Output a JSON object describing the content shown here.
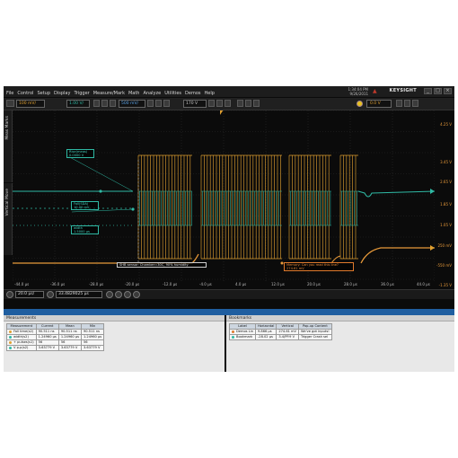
{
  "window": {
    "sysinfo_line1": "1:34:04 PM",
    "sysinfo_line2": "9/26/2011",
    "brand": "KEYSIGHT",
    "menu": [
      "File",
      "Control",
      "Setup",
      "Display",
      "Trigger",
      "Measure/Mark",
      "Math",
      "Analyze",
      "Utilities",
      "Demos",
      "Help"
    ]
  },
  "toolbar": {
    "chan1": "100 mV/",
    "chan2": "1.00 V/",
    "chan3": "500 mV/",
    "chan4": "170 V",
    "trigger": "0.0 V"
  },
  "sidetabs": {
    "left_a": "Meas Marks",
    "left_b": "Vertical Move"
  },
  "y_labels": [
    "4.25 V",
    "3.45 V",
    "2.65 V",
    "1.85 V",
    "1.05 V",
    "250 mV",
    "-550 mV",
    "-1.35 V"
  ],
  "x_labels": [
    "-44.0 µs",
    "-36.0 µs",
    "-28.0 µs",
    "-20.0 µs",
    "-12.0 µs",
    "-4.0 µs",
    "4.0 µs",
    "12.0 µs",
    "20.0 µs",
    "28.0 µs",
    "36.0 µs",
    "44.0 µs"
  ],
  "annotations": {
    "g1_line1": "Rise(meas)",
    "g1_line2": "0.0000 V",
    "g2_line1": "Fall(SDA)",
    "g2_line2": "10.00 mV",
    "g3_line1": "width",
    "g3_line2": "1.5000 µs",
    "white": "SHB sensor: Chamber=30C, 90% humidity",
    "orange_line1": "Memory: Can you read this line?",
    "orange_line2": "274.61 mV"
  },
  "hbar": {
    "timebase": "20.0 µs/",
    "delay": "33.4829025 µs"
  },
  "panel_header": "Results - Measurement & Logic",
  "measurements": {
    "title": "Measurements",
    "columns": [
      "Measurement",
      "Current",
      "Mean",
      "Min"
    ],
    "rows": [
      {
        "name": "Fall time(s2)",
        "current": "90.511 ns",
        "mean": "90.511 ns",
        "min": "90.511 ns",
        "color": "#e0a030"
      },
      {
        "name": "width(s2)",
        "current": "1.24960 µs",
        "mean": "1.24960 µs",
        "min": "1.24960 µs",
        "color": "#2fb9a4"
      },
      {
        "name": "+ pulses(s1)",
        "current": "56",
        "mean": "56",
        "min": "56",
        "color": "#e0a030"
      },
      {
        "name": "V p-p(s2)",
        "current": "3.63779 V",
        "mean": "3.63779 V",
        "min": "3.63779 V",
        "color": "#2fb9a4"
      }
    ]
  },
  "bookmarks": {
    "title": "Bookmarks",
    "columns": [
      "Label",
      "Horizontal",
      "Vertical",
      "Pop-up Content"
    ],
    "rows": [
      {
        "label": "Demos Lin",
        "horizontal": "9.866 µs",
        "vertical": "274.61 mV",
        "popup": "We've got inputs!",
        "color": "#e07a2c"
      },
      {
        "label": "Bookmark",
        "horizontal": "-28.02 µs",
        "vertical": "3.4/PP.9 V",
        "popup": "Trigger Crash sel",
        "color": "#2fb9a4"
      }
    ]
  }
}
